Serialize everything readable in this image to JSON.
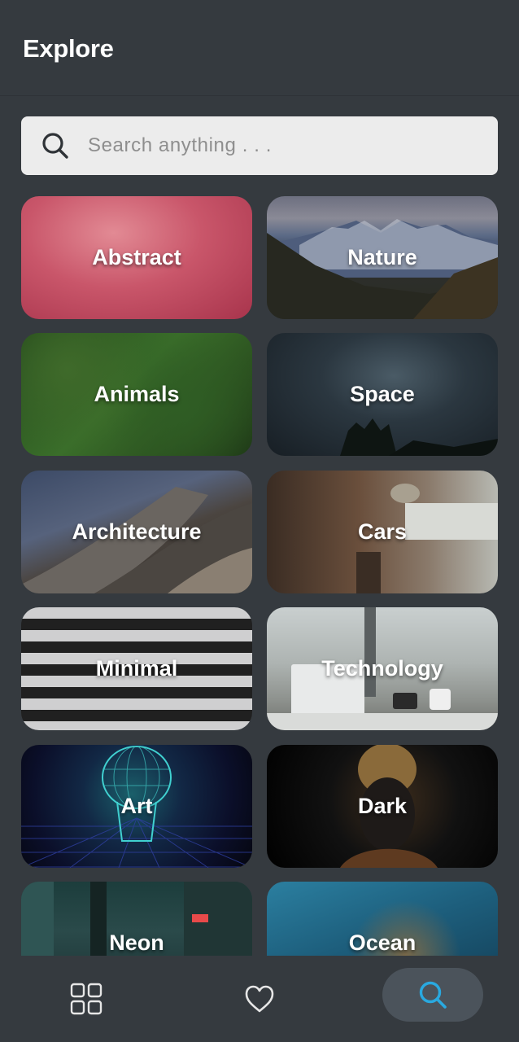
{
  "header": {
    "title": "Explore"
  },
  "search": {
    "placeholder": "Search anything . . .",
    "icon": "search-icon"
  },
  "categories": [
    {
      "label": "Abstract",
      "color": "#c9566a"
    },
    {
      "label": "Nature",
      "color": "#5b6a86"
    },
    {
      "label": "Animals",
      "color": "#3a6e2a"
    },
    {
      "label": "Space",
      "color": "#2b3740"
    },
    {
      "label": "Architecture",
      "color": "#56627c"
    },
    {
      "label": "Cars",
      "color": "#6a4f3c"
    },
    {
      "label": "Minimal",
      "color": "#cfcfd0"
    },
    {
      "label": "Technology",
      "color": "#aeb4b2"
    },
    {
      "label": "Art",
      "color": "#122845"
    },
    {
      "label": "Dark",
      "color": "#111111"
    },
    {
      "label": "Neon",
      "color": "#2a4a4a"
    },
    {
      "label": "Ocean",
      "color": "#1d5e7c"
    }
  ],
  "bottom_nav": {
    "items": [
      {
        "icon": "grid-icon",
        "active": false
      },
      {
        "icon": "heart-icon",
        "active": false
      },
      {
        "icon": "search-icon",
        "active": true
      }
    ],
    "active_color": "#29a9e0"
  }
}
